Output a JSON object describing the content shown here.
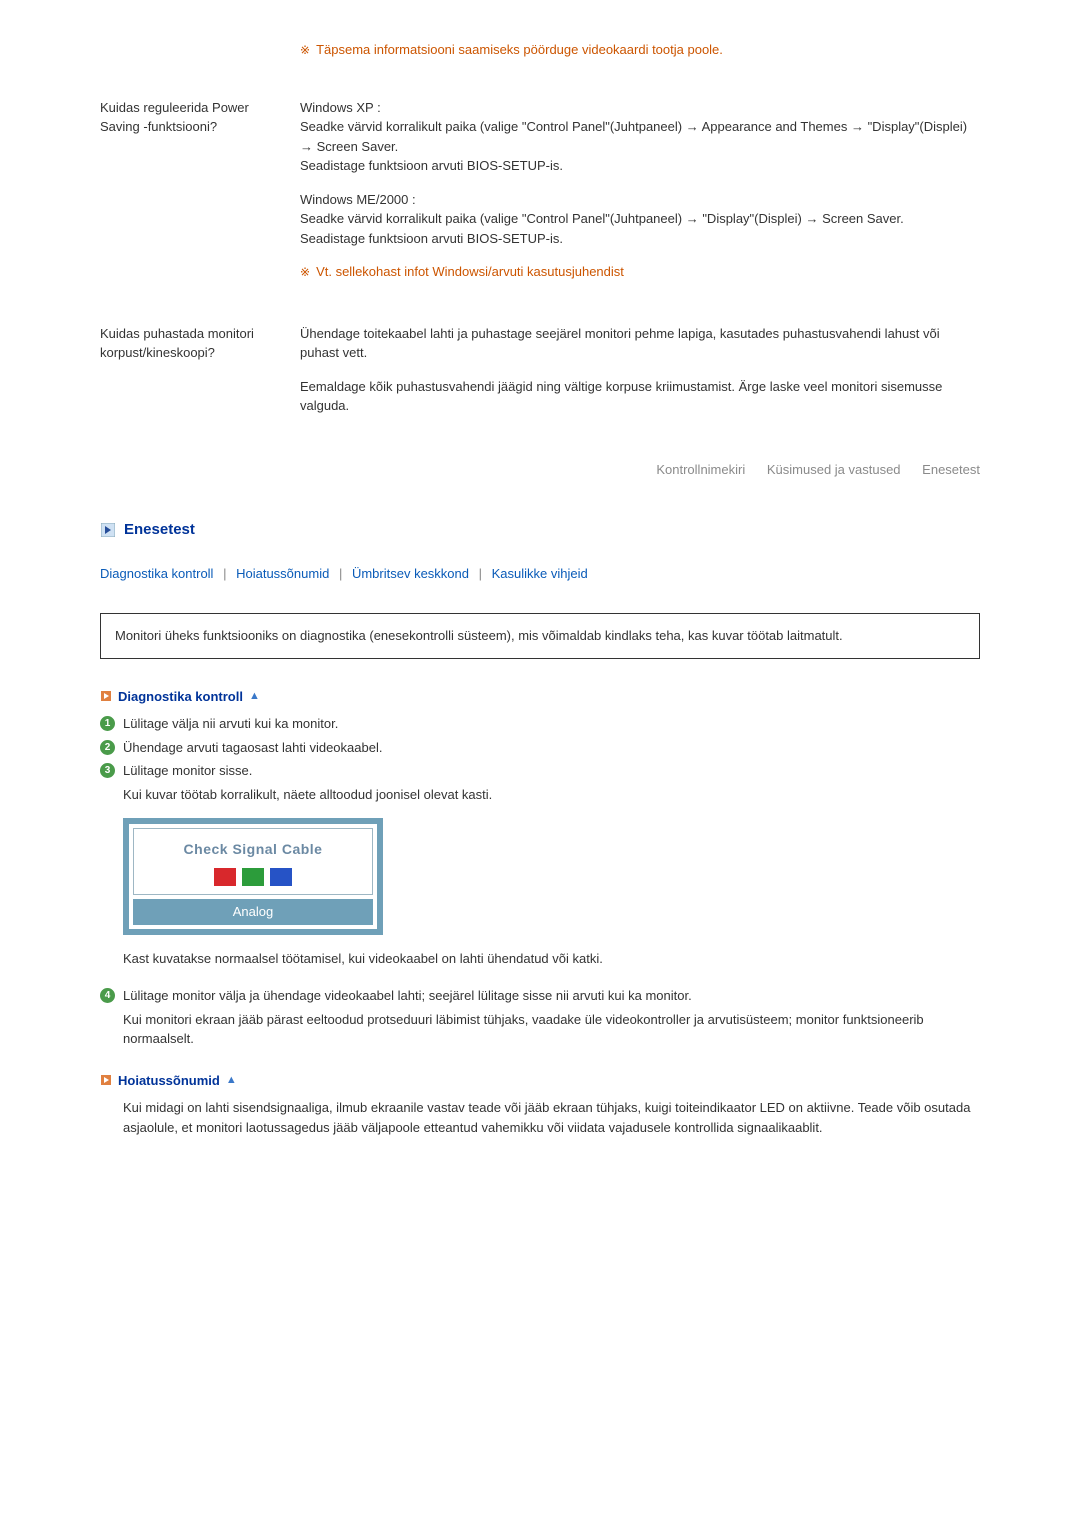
{
  "qa": [
    {
      "q": "",
      "answers": [
        {
          "note": true,
          "text": "Täpsema informatsiooni saamiseks pöörduge videokaardi tootja poole."
        }
      ]
    },
    {
      "q": "Kuidas reguleerida Power Saving -funktsiooni?",
      "answers": [
        {
          "text": "Windows XP :\nSeadke värvid korralikult paika (valige \"Control Panel\"(Juhtpaneel) → Appearance and Themes → \"Display\"(Displei) → Screen Saver.\nSeadistage funktsioon arvuti BIOS-SETUP-is."
        },
        {
          "text": "Windows ME/2000 :\nSeadke värvid korralikult paika (valige \"Control Panel\"(Juhtpaneel) → \"Display\"(Displei) → Screen Saver.\nSeadistage funktsioon arvuti BIOS-SETUP-is."
        },
        {
          "note": true,
          "text": "Vt. sellekohast infot Windowsi/arvuti kasutusjuhendist"
        }
      ]
    },
    {
      "q": "Kuidas puhastada monitori korpust/kineskoopi?",
      "answers": [
        {
          "text": "Ühendage toitekaabel lahti ja puhastage seejärel monitori pehme lapiga, kasutades puhastusvahendi lahust või puhast vett."
        },
        {
          "text": "Eemaldage kõik puhastusvahendi jäägid ning vältige korpuse kriimustamist. Ärge laske veel monitori sisemusse valguda."
        }
      ]
    }
  ],
  "tabs": {
    "t1": "Kontrollnimekiri",
    "t2": "Küsimused ja vastused",
    "t3": "Enesetest"
  },
  "section": {
    "title": "Enesetest"
  },
  "links": {
    "l1": "Diagnostika kontroll",
    "l2": "Hoiatussõnumid",
    "l3": "Ümbritsev keskkond",
    "l4": "Kasulikke vihjeid"
  },
  "intro": "Monitori üheks funktsiooniks on diagnostika (enesekontrolli süsteem), mis võimaldab kindlaks teha, kas kuvar töötab laitmatult.",
  "diag": {
    "heading": "Diagnostika kontroll",
    "steps": [
      "Lülitage välja nii arvuti kui ka monitor.",
      "Ühendage arvuti tagaosast lahti videokaabel.",
      "Lülitage monitor sisse."
    ],
    "step3_sub": "Kui kuvar töötab korralikult, näete alltoodud joonisel olevat kasti.",
    "cable_title": "Check Signal Cable",
    "cable_footer": "Analog",
    "after_img": "Kast kuvatakse normaalsel töötamisel, kui videokaabel on lahti ühendatud või katki.",
    "step4": "Lülitage monitor välja ja ühendage videokaabel lahti; seejärel lülitage sisse nii arvuti kui ka monitor.",
    "step4_sub": "Kui monitori ekraan jääb pärast eeltoodud protseduuri läbimist tühjaks, vaadake üle videokontroller ja arvutisüsteem; monitor funktsioneerib normaalselt."
  },
  "warn": {
    "heading": "Hoiatussõnumid",
    "text": "Kui midagi on lahti sisendsignaaliga, ilmub ekraanile vastav teade või jääb ekraan tühjaks, kuigi toiteindikaator LED on aktiivne. Teade võib osutada asjaolule, et monitori laotussagedus jääb väljapoole etteantud vahemikku või viidata vajadusele kontrollida signaalikaablit."
  }
}
